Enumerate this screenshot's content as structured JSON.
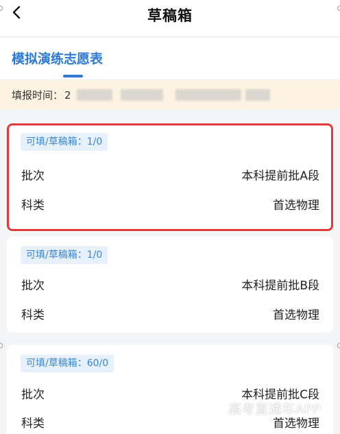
{
  "header": {
    "title": "草稿箱",
    "back_icon": "chevron-left-icon"
  },
  "tabs": [
    {
      "label": "模拟演练志愿表",
      "active": true
    }
  ],
  "fill_time": {
    "label": "填报时间：",
    "value_visible_prefix": "2"
  },
  "cards": [
    {
      "badge": "可填/草稿箱：1/0",
      "rows": [
        {
          "label": "批次",
          "value": "本科提前批A段"
        },
        {
          "label": "科类",
          "value": "首选物理"
        }
      ],
      "highlighted": true
    },
    {
      "badge": "可填/草稿箱：1/0",
      "rows": [
        {
          "label": "批次",
          "value": "本科提前批B段"
        },
        {
          "label": "科类",
          "value": "首选物理"
        }
      ],
      "highlighted": false
    },
    {
      "badge": "可填/草稿箱：60/0",
      "rows": [
        {
          "label": "批次",
          "value": "本科提前批C段"
        },
        {
          "label": "科类",
          "value": "首选物理"
        }
      ],
      "highlighted": false
    }
  ],
  "watermark": "高考直通车APP",
  "colors": {
    "accent": "#2d7ad6",
    "badge_bg": "#e6f1fb",
    "badge_text": "#3a86d8",
    "notice_bg": "#fdf3e3",
    "highlight_border": "#e03a3a"
  }
}
